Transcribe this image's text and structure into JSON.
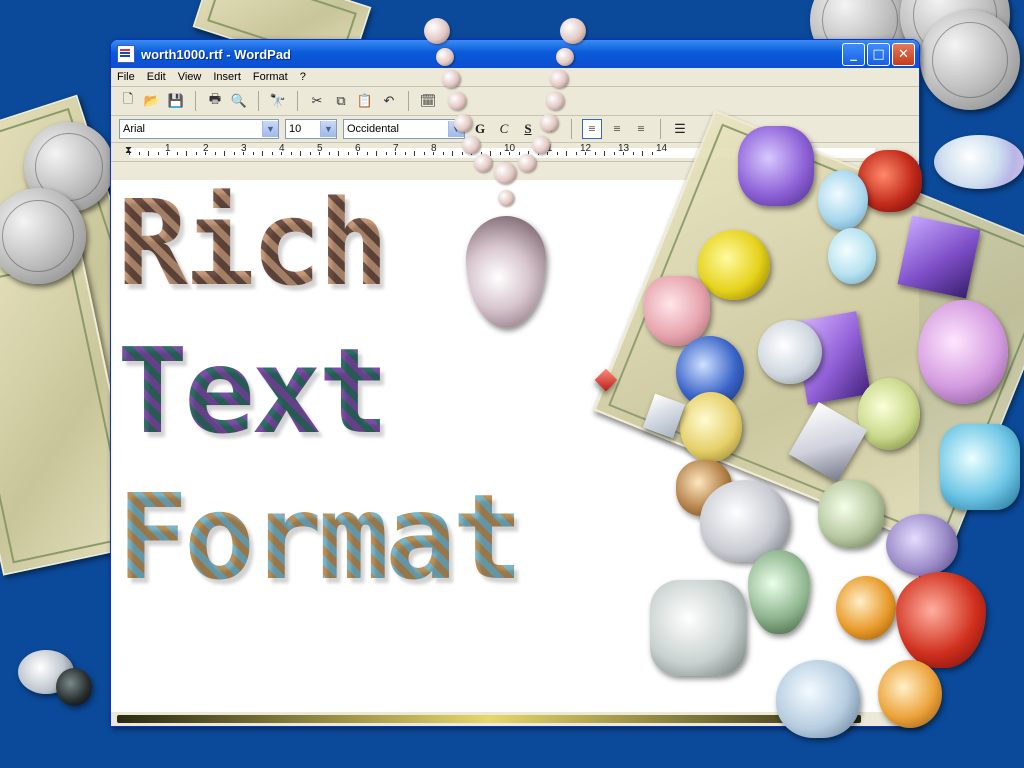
{
  "window": {
    "title": "worth1000.rtf - WordPad",
    "controls": {
      "minimize": "_",
      "maximize": "□",
      "close": "✕"
    }
  },
  "menu": [
    "File",
    "Edit",
    "View",
    "Insert",
    "Format",
    "?"
  ],
  "toolbar": {
    "icons": [
      "new-icon",
      "open-icon",
      "save-icon",
      "print-icon",
      "print-preview-icon",
      "find-icon",
      "cut-icon",
      "copy-icon",
      "paste-icon",
      "undo-icon",
      "date-time-icon"
    ]
  },
  "format_bar": {
    "font": "Arial",
    "size": "10",
    "script": "Occidental",
    "bold_label": "G",
    "italic_label": "C",
    "underline_label": "S"
  },
  "ruler": {
    "numbers": [
      "1",
      "2",
      "3",
      "4",
      "5",
      "6",
      "7",
      "8",
      "9",
      "10",
      "11",
      "12",
      "13",
      "14"
    ]
  },
  "document": {
    "lines": [
      "Rich",
      "Text",
      "Format"
    ]
  },
  "colors": {
    "desktop": "#0b4a9a",
    "window_frame": "#0831d9",
    "titlebar": "#0a5ad9",
    "face": "#ece9d8"
  }
}
